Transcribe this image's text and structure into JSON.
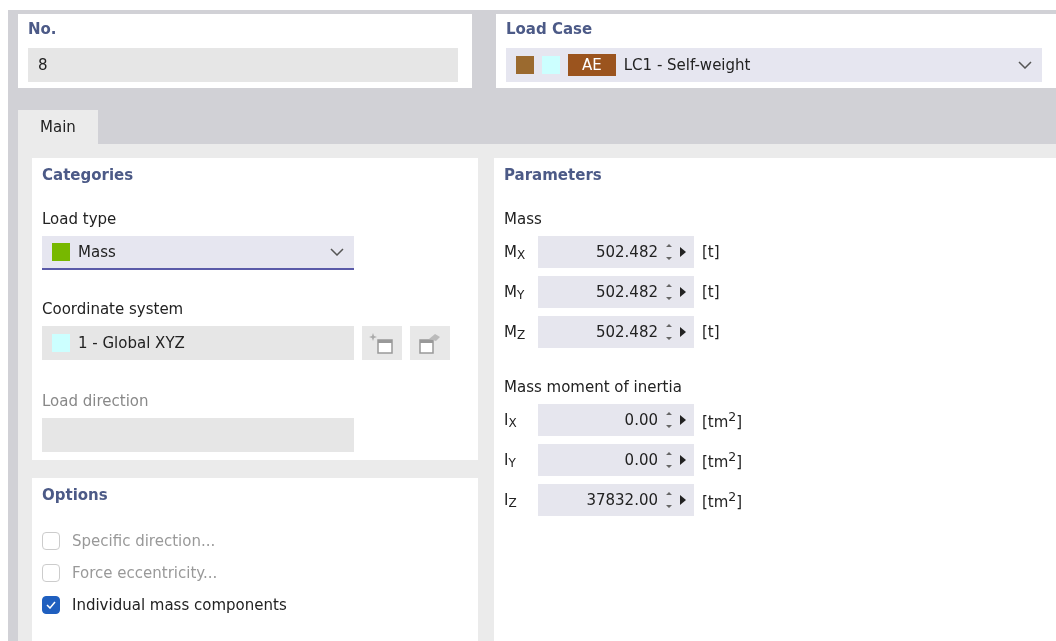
{
  "number": {
    "label": "No.",
    "value": "8"
  },
  "load_case": {
    "label": "Load Case",
    "swatches": [
      {
        "color": "#9b6a2f"
      },
      {
        "color": "#ccffff"
      }
    ],
    "tag": {
      "text": "AE",
      "color": "#9b541e"
    },
    "value": "LC1 - Self-weight"
  },
  "tabs": [
    {
      "label": "Main",
      "selected": true
    }
  ],
  "categories": {
    "title": "Categories",
    "load_type": {
      "label": "Load type",
      "color": "#77b800",
      "value": "Mass"
    },
    "coordinate_system": {
      "label": "Coordinate system",
      "color": "#ccffff",
      "value": "1 - Global XYZ"
    },
    "load_direction": {
      "label": "Load direction",
      "disabled": true
    }
  },
  "options": {
    "title": "Options",
    "items": [
      {
        "label": "Specific direction...",
        "checked": false,
        "disabled": true
      },
      {
        "label": "Force eccentricity...",
        "checked": false,
        "disabled": true
      },
      {
        "label": "Individual mass components",
        "checked": true,
        "disabled": false
      }
    ]
  },
  "parameters": {
    "title": "Parameters",
    "groups": [
      {
        "title": "Mass",
        "rows": [
          {
            "symbol": "M$_{X}$",
            "value": "502.482",
            "unit": "[t]"
          },
          {
            "symbol": "M$_{Y}$",
            "value": "502.482",
            "unit": "[t]"
          },
          {
            "symbol": "M$_{Z}$",
            "value": "502.482",
            "unit": "[t]"
          }
        ]
      },
      {
        "title": "Mass moment of inertia",
        "rows": [
          {
            "symbol": "I$_{X}$",
            "value": "0.00",
            "unit": "[tm$^{2}$]"
          },
          {
            "symbol": "I$_{Y}$",
            "value": "0.00",
            "unit": "[tm$^{2}$]"
          },
          {
            "symbol": "I$_{Z}$",
            "value": "37832.00",
            "unit": "[tm$^{2}$]"
          }
        ]
      }
    ]
  }
}
